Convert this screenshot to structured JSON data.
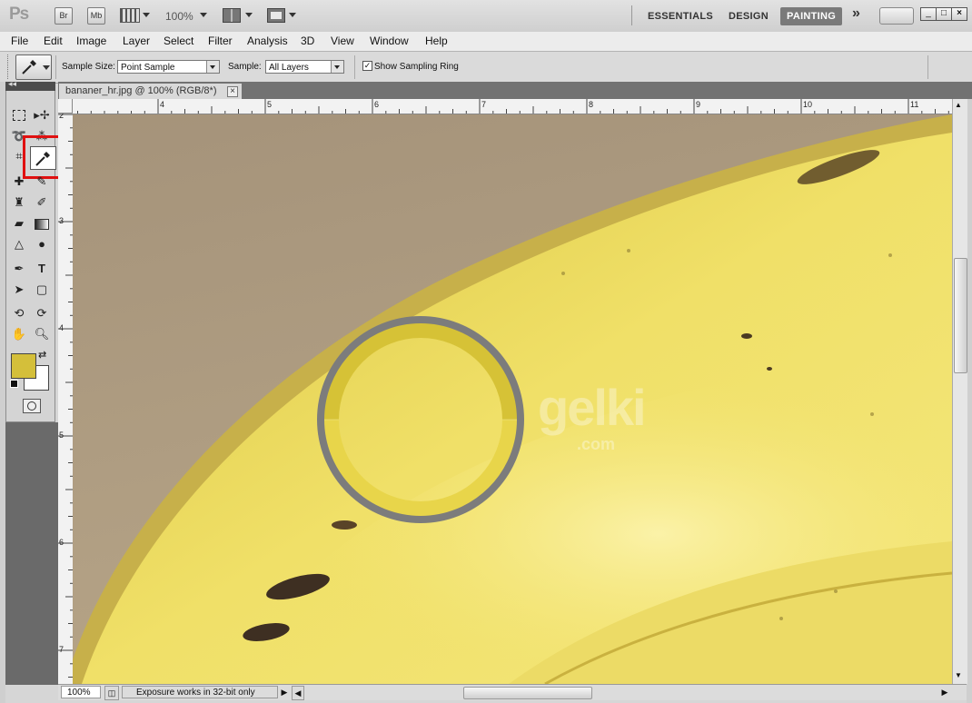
{
  "app_bar": {
    "logo": "Ps",
    "bridge_label": "Br",
    "minibridge_label": "Mb",
    "zoom_value": "100%",
    "workspaces": [
      "ESSENTIALS",
      "DESIGN",
      "PAINTING"
    ],
    "active_workspace": "PAINTING",
    "more_label": "»"
  },
  "menu": [
    "File",
    "Edit",
    "Image",
    "Layer",
    "Select",
    "Filter",
    "Analysis",
    "3D",
    "View",
    "Window",
    "Help"
  ],
  "options_bar": {
    "sample_size_label": "Sample Size:",
    "sample_size_value": "Point Sample",
    "sample_label": "Sample:",
    "sample_value": "All Layers",
    "show_ring_label": "Show Sampling Ring",
    "show_ring_checked": true
  },
  "document": {
    "tab_title": "bananer_hr.jpg @ 100% (RGB/8*)",
    "close_glyph": "×"
  },
  "rulers": {
    "horizontal": [
      "4",
      "5",
      "6",
      "7",
      "8",
      "9",
      "10",
      "11"
    ],
    "vertical": [
      "2",
      "3",
      "4",
      "5",
      "6",
      "7"
    ]
  },
  "watermark": {
    "main": "gelki",
    "sub": ".com"
  },
  "colors": {
    "foreground": "#d4bf3a",
    "background": "#ffffff",
    "highlight": "#e01010",
    "ring_outer": "#7c7c7c",
    "ring_current": "#d6c236",
    "ring_previous": "#e8d54a"
  },
  "status_bar": {
    "zoom": "100%",
    "message": "Exposure works in 32-bit only"
  }
}
